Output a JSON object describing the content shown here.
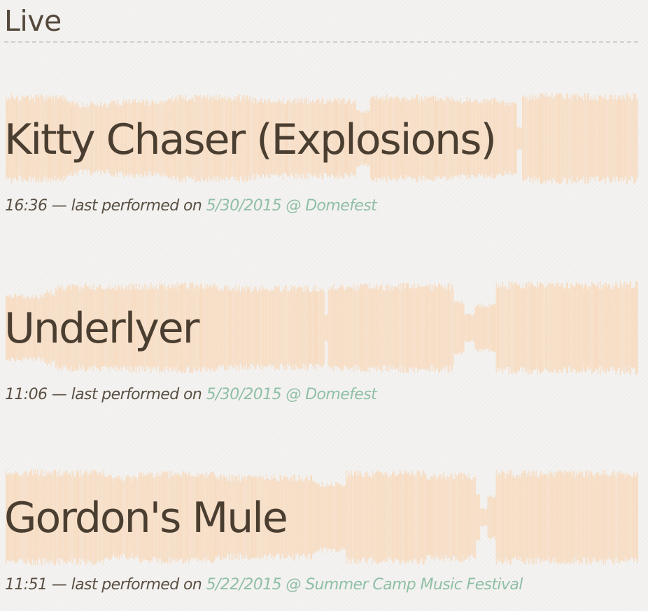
{
  "section": {
    "title": "Live"
  },
  "colors": {
    "waveform": "#f7dcc2",
    "title_text": "#4a3e31",
    "link": "#8fbfa6",
    "rule": "#d2cec8"
  },
  "tracks": [
    {
      "title": "Kitty Chaser (Explosions)",
      "duration": "16:36",
      "separator": " — last performed on ",
      "date": "5/30/2015",
      "at": " @ ",
      "venue": "Domefest"
    },
    {
      "title": "Underlyer",
      "duration": "11:06",
      "separator": " — last performed on ",
      "date": "5/30/2015",
      "at": " @ ",
      "venue": "Domefest"
    },
    {
      "title": "Gordon's Mule",
      "duration": "11:51",
      "separator": " — last performed on ",
      "date": "5/22/2015",
      "at": " @ ",
      "venue": "Summer Camp Music Festival"
    }
  ]
}
